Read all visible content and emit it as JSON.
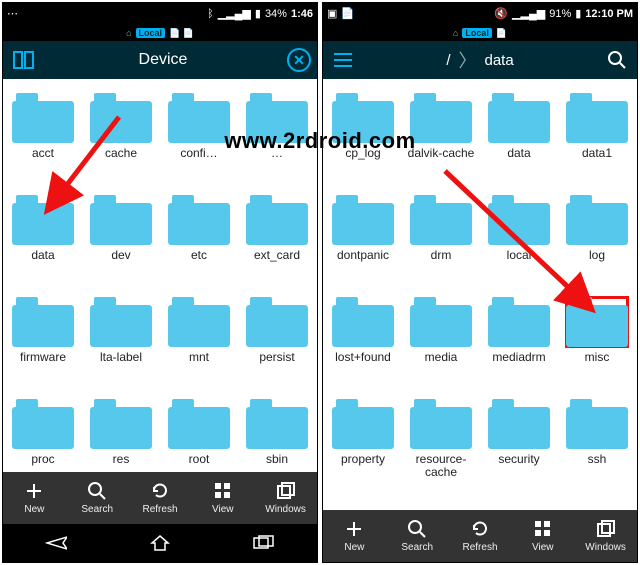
{
  "watermark": "www.2rdroid.com",
  "left": {
    "status": {
      "battery": "34%",
      "time": "1:46"
    },
    "minibar": {
      "home_icon": "⌂",
      "label": "Local",
      "extra": "📄 📄"
    },
    "header": {
      "title": "Device"
    },
    "folders": [
      "acct",
      "cache",
      "confi…",
      "…",
      "data",
      "dev",
      "etc",
      "ext_card",
      "firmware",
      "lta-label",
      "mnt",
      "persist",
      "proc",
      "res",
      "root",
      "sbin"
    ],
    "toolbar": [
      "New",
      "Search",
      "Refresh",
      "View",
      "Windows"
    ]
  },
  "right": {
    "status": {
      "battery": "91%",
      "time": "12:10 PM"
    },
    "minibar": {
      "home_icon": "⌂",
      "label": "Local",
      "extra": ""
    },
    "header": {
      "crumbs": [
        "/",
        "〉",
        "data"
      ]
    },
    "folders": [
      "cp_log",
      "dalvik-cache",
      "data",
      "data1",
      "dontpanic",
      "drm",
      "local",
      "log",
      "lost+found",
      "media",
      "mediadrm",
      "misc",
      "property",
      "resource-cache",
      "security",
      "ssh"
    ],
    "highlight_index": 11,
    "toolbar": [
      "New",
      "Search",
      "Refresh",
      "View",
      "Windows"
    ]
  }
}
